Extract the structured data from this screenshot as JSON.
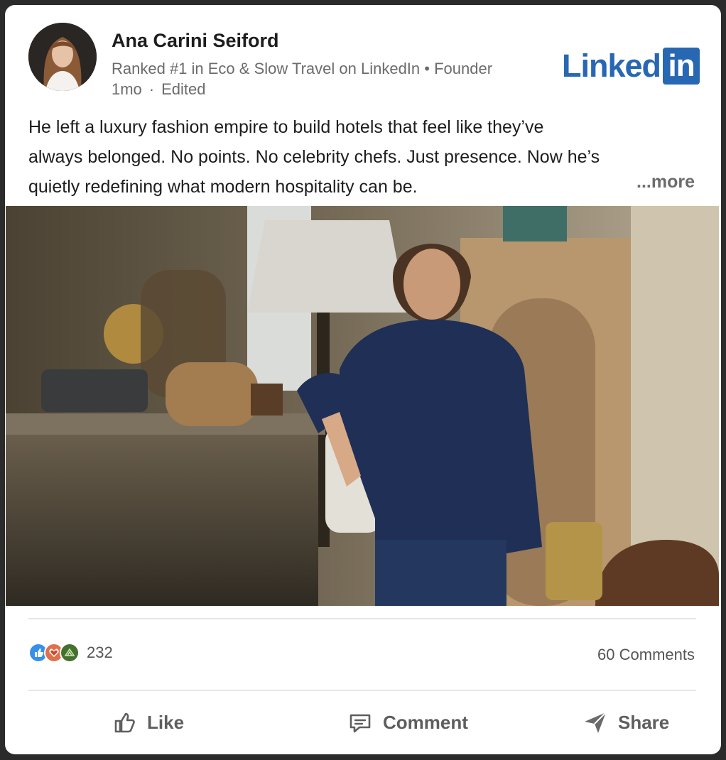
{
  "author": {
    "name": "Ana Carini Seiford",
    "headline": "Ranked #1 in Eco & Slow Travel on LinkedIn • Founder",
    "time": "1mo",
    "separator": "·",
    "edited": "Edited",
    "avatar_icon": "profile-photo"
  },
  "brand": {
    "word": "Linked",
    "box": "in",
    "color": "#2867b2"
  },
  "post": {
    "lines": [
      "He left a luxury fashion empire to build hotels that feel like they’ve",
      "always belonged. No points. No celebrity chefs. Just presence. Now he’s",
      "quietly redefining what modern hospitality can be."
    ],
    "more_label": "...more"
  },
  "stats": {
    "reaction_icons": [
      "like-icon",
      "love-icon",
      "support-icon"
    ],
    "reaction_count": "232",
    "comments": "60 Comments"
  },
  "actions": {
    "like": "Like",
    "comment": "Comment",
    "share": "Share"
  }
}
